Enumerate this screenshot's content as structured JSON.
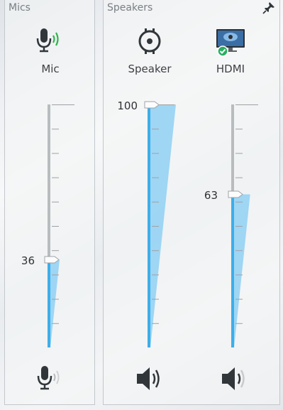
{
  "mics": {
    "title": "Mics",
    "devices": [
      {
        "label": "Mic",
        "value": 36,
        "value_text": "36",
        "icon": "microphone-icon"
      }
    ]
  },
  "speakers": {
    "title": "Speakers",
    "pin_icon": "pin-icon",
    "devices": [
      {
        "label": "Speaker",
        "value": 100,
        "value_text": "100",
        "icon": "speaker-device-icon"
      },
      {
        "label": "HDMI",
        "value": 63,
        "value_text": "63",
        "icon": "hdmi-display-icon"
      }
    ]
  },
  "colors": {
    "accent": "#3daee9",
    "accent_light": "#8fd0f3",
    "track": "#b9bcbf",
    "mic_wave": "#2fb34a",
    "status_ok": "#27ae60"
  }
}
